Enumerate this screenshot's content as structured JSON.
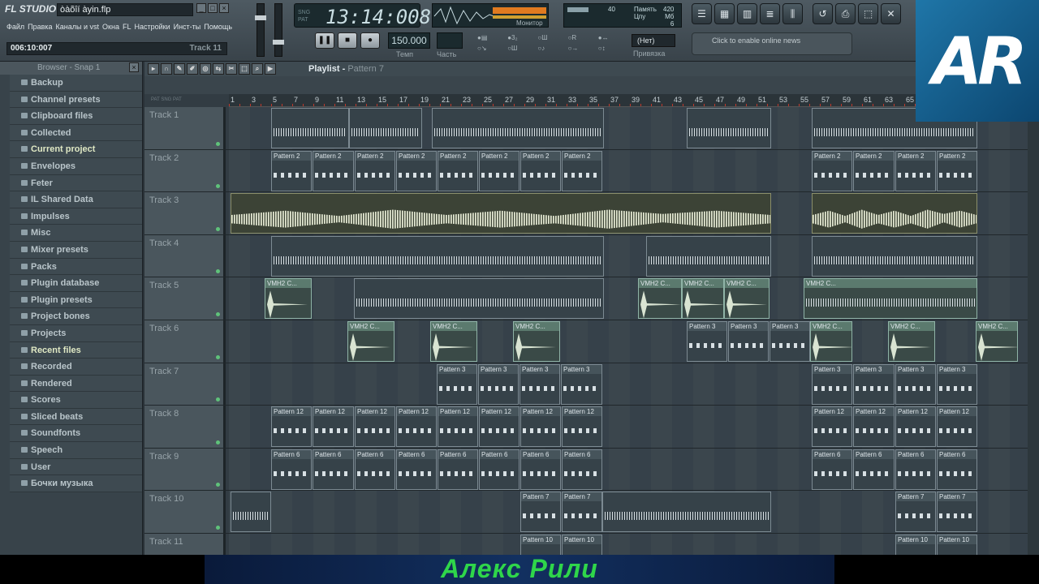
{
  "app": {
    "logo": "FL STUDIO",
    "filename": "òàõîí àyin.flp"
  },
  "menu": [
    "Файл",
    "Правка",
    "Каналы и vst",
    "Окна",
    "FL",
    "Настройки",
    "Инст-ты",
    "Помощь"
  ],
  "status": {
    "time": "006:10:007",
    "track": "Track 11"
  },
  "lcd": {
    "time": "13:14:008",
    "mode_top": "SNG",
    "mode_bottom": "PAT"
  },
  "transport": {
    "pause": "❚❚",
    "stop": "■",
    "record": "●"
  },
  "tempo": {
    "value": "150.000",
    "label": "Темп"
  },
  "part": {
    "label": "Часть"
  },
  "monitor": {
    "label": "Монитор"
  },
  "cpu": {
    "mem_label": "Память",
    "cpu_label": "Цпу",
    "mem_value": "420",
    "mb": "Мб",
    "no_label": "№",
    "poly": "6",
    "val40": "40"
  },
  "snap": {
    "value": "(Нет)",
    "label": "Привязка"
  },
  "news": {
    "text": "Click to enable online news"
  },
  "watermark": {
    "text": "AR"
  },
  "browser": {
    "title": "Browser - Snap 1",
    "items": [
      "Backup",
      "Channel presets",
      "Clipboard files",
      "Collected",
      "Current project",
      "Envelopes",
      "Feter",
      "IL Shared Data",
      "Impulses",
      "Misc",
      "Mixer presets",
      "Packs",
      "Plugin database",
      "Plugin presets",
      "Project bones",
      "Projects",
      "Recent files",
      "Recorded",
      "Rendered",
      "Scores",
      "Sliced beats",
      "Soundfonts",
      "Speech",
      "User",
      "Бочки музыка"
    ]
  },
  "playlist": {
    "title": "Playlist",
    "pattern": "Pattern 7",
    "ruler": [
      "1",
      "3",
      "5",
      "7",
      "9",
      "11",
      "13",
      "15",
      "17",
      "19",
      "21",
      "23",
      "25",
      "27",
      "29",
      "31",
      "33",
      "35",
      "37",
      "39",
      "41",
      "43",
      "45",
      "47",
      "49",
      "51",
      "53",
      "55",
      "57",
      "59",
      "61",
      "63",
      "65"
    ],
    "tracks": [
      "Track 1",
      "Track 2",
      "Track 3",
      "Track 4",
      "Track 5",
      "Track 6",
      "Track 7",
      "Track 8",
      "Track 9",
      "Track 10",
      "Track 11"
    ],
    "clip_labels": {
      "p2": "Pattern 2",
      "p3": "Pattern 3",
      "p12": "Pattern 12",
      "p6": "Pattern 6",
      "p7": "Pattern 7",
      "p10": "Pattern 10",
      "vmh": "VMH2 C..."
    }
  },
  "caption": {
    "text": "Алекс Рили"
  }
}
